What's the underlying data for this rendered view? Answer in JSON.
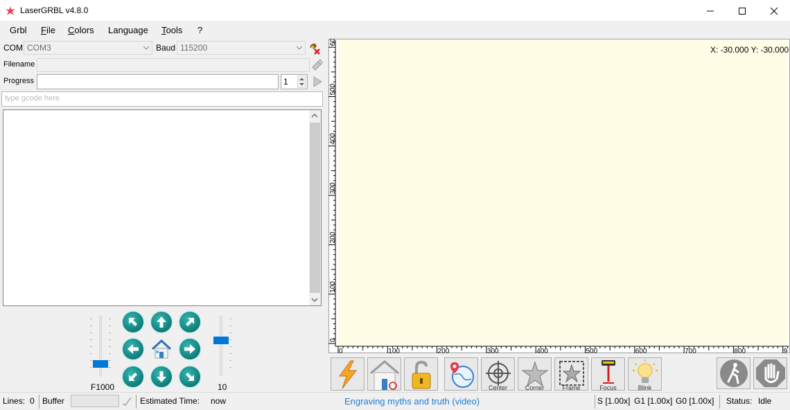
{
  "window": {
    "title": "LaserGRBL v4.8.0"
  },
  "menu": {
    "grbl": "Grbl",
    "file_u": "F",
    "file_rest": "ile",
    "colors_u": "C",
    "colors_rest": "olors",
    "language": "Language",
    "tools_u": "T",
    "tools_rest": "ools",
    "help": "?"
  },
  "connection": {
    "com_label": "COM",
    "com_value": "COM3",
    "baud_label": "Baud",
    "baud_value": "115200"
  },
  "file": {
    "filename_label": "Filename",
    "progress_label": "Progress",
    "copies": "1"
  },
  "gcode": {
    "placeholder": "type gcode here"
  },
  "jog": {
    "speed_label": "F1000",
    "step_label": "10",
    "speed_level": 0.15,
    "step_level": 0.6
  },
  "canvas": {
    "coords": "X: -30.000 Y: -30.000",
    "x_ticks": [
      "0",
      "100",
      "200",
      "300",
      "400",
      "500",
      "600",
      "700",
      "800",
      "9"
    ],
    "y_ticks": [
      "0",
      "100",
      "200",
      "300",
      "400",
      "500",
      "60"
    ]
  },
  "toolbar": {
    "center": "Center",
    "corner": "Corner",
    "frame": "Frame",
    "focus": "Focus",
    "blink": "Blink"
  },
  "status": {
    "lines_label": "Lines:",
    "lines_value": "0",
    "buffer_label": "Buffer",
    "est_label": "Estimated Time:",
    "est_value": "now",
    "link": "Engraving myths and truth (video)",
    "s_override": "S [1.00x]",
    "g1_override": "G1 [1.00x]",
    "g0_override": "G0 [1.00x]",
    "status_label": "Status:",
    "status_value": "Idle"
  },
  "colors": {
    "canvas_bg": "#fffde5",
    "jog_teal": "#139694",
    "slider_handle": "#0078d7",
    "link": "#1e7bd4"
  }
}
